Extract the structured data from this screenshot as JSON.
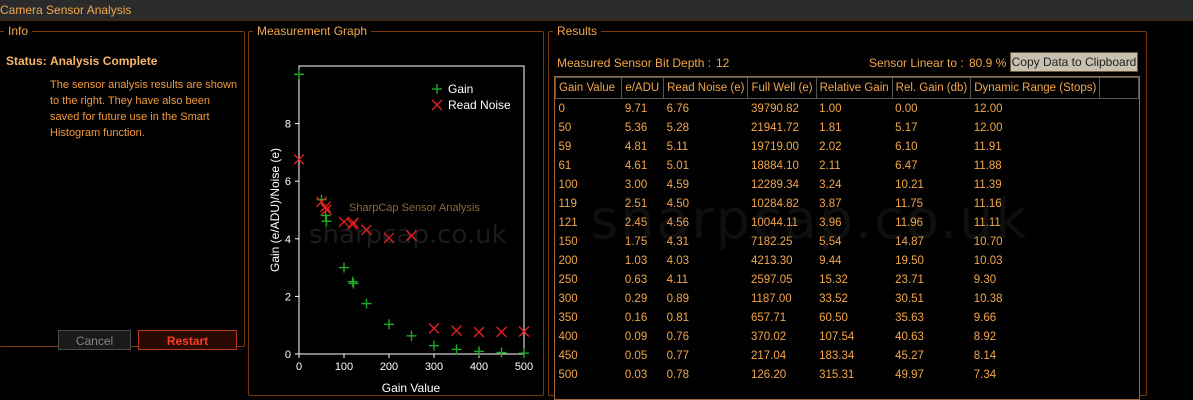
{
  "window": {
    "title": "Camera Sensor Analysis"
  },
  "info": {
    "legend": "Info",
    "status_label": "Status:",
    "status_value": "Analysis Complete",
    "description": "The sensor analysis results are shown to the right. They have also been saved for future use in the Smart Histogram function.",
    "cancel_label": "Cancel",
    "restart_label": "Restart"
  },
  "graph": {
    "legend": "Measurement Graph",
    "watermark_title": "SharpCap Sensor Analysis",
    "watermark_site": "sharpcap.co.uk"
  },
  "results": {
    "legend": "Results",
    "bit_depth_label": "Measured Sensor Bit Depth :",
    "bit_depth_value": "12",
    "linear_label": "Sensor Linear to :",
    "linear_value": "80.9 %",
    "copy_label": "Copy Data to Clipboard",
    "watermark": "sharpcap.co.uk",
    "columns": [
      "Gain Value",
      "e/ADU",
      "Read Noise (e)",
      "Full Well (e)",
      "Relative Gain",
      "Rel. Gain (db)",
      "Dynamic Range (Stops)"
    ],
    "rows": [
      [
        "0",
        "9.71",
        "6.76",
        "39790.82",
        "1.00",
        "0.00",
        "12.00"
      ],
      [
        "50",
        "5.36",
        "5.28",
        "21941.72",
        "1.81",
        "5.17",
        "12.00"
      ],
      [
        "59",
        "4.81",
        "5.11",
        "19719.00",
        "2.02",
        "6.10",
        "11.91"
      ],
      [
        "61",
        "4.61",
        "5.01",
        "18884.10",
        "2.11",
        "6.47",
        "11.88"
      ],
      [
        "100",
        "3.00",
        "4.59",
        "12289.34",
        "3.24",
        "10.21",
        "11.39"
      ],
      [
        "119",
        "2.51",
        "4.50",
        "10284.82",
        "3.87",
        "11.75",
        "11.16"
      ],
      [
        "121",
        "2.45",
        "4.56",
        "10044.11",
        "3.96",
        "11.96",
        "11.11"
      ],
      [
        "150",
        "1.75",
        "4.31",
        "7182.25",
        "5.54",
        "14.87",
        "10.70"
      ],
      [
        "200",
        "1.03",
        "4.03",
        "4213.30",
        "9.44",
        "19.50",
        "10.03"
      ],
      [
        "250",
        "0.63",
        "4.11",
        "2597.05",
        "15.32",
        "23.71",
        "9.30"
      ],
      [
        "300",
        "0.29",
        "0.89",
        "1187.00",
        "33.52",
        "30.51",
        "10.38"
      ],
      [
        "350",
        "0.16",
        "0.81",
        "657.71",
        "60.50",
        "35.63",
        "9.66"
      ],
      [
        "400",
        "0.09",
        "0.76",
        "370.02",
        "107.54",
        "40.63",
        "8.92"
      ],
      [
        "450",
        "0.05",
        "0.77",
        "217.04",
        "183.34",
        "45.27",
        "8.14"
      ],
      [
        "500",
        "0.03",
        "0.78",
        "126.20",
        "315.31",
        "49.97",
        "7.34"
      ]
    ]
  },
  "chart_data": {
    "type": "scatter",
    "xlabel": "Gain Value",
    "ylabel": "Gain (e/ADU)/Noise (e)",
    "xlim": [
      0,
      500
    ],
    "ylim": [
      0,
      10
    ],
    "xticks": [
      "0",
      "100",
      "200",
      "300",
      "400",
      "500"
    ],
    "yticks": [
      "0",
      "2",
      "4",
      "6",
      "8"
    ],
    "legend_position": "top-right",
    "series": [
      {
        "name": "Gain",
        "marker": "plus",
        "color": "#1fa82a",
        "x": [
          0,
          50,
          59,
          61,
          100,
          119,
          121,
          150,
          200,
          250,
          300,
          350,
          400,
          450,
          500
        ],
        "y": [
          9.71,
          5.36,
          4.81,
          4.61,
          3.0,
          2.51,
          2.45,
          1.75,
          1.03,
          0.63,
          0.29,
          0.16,
          0.09,
          0.05,
          0.03
        ]
      },
      {
        "name": "Read Noise",
        "marker": "cross",
        "color": "#e0201e",
        "x": [
          0,
          50,
          59,
          61,
          100,
          119,
          121,
          150,
          200,
          250,
          300,
          350,
          400,
          450,
          500
        ],
        "y": [
          6.76,
          5.28,
          5.11,
          5.01,
          4.59,
          4.5,
          4.56,
          4.31,
          4.03,
          4.11,
          0.89,
          0.81,
          0.76,
          0.77,
          0.78
        ]
      }
    ]
  }
}
